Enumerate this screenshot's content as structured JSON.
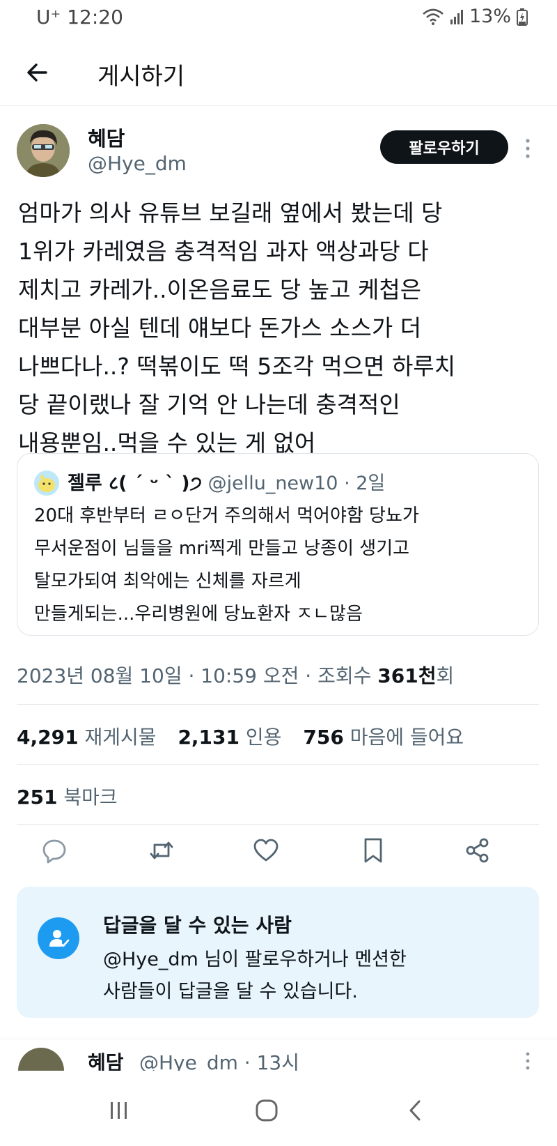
{
  "status_bar": {
    "carrier": "U⁺",
    "time": "12:20",
    "battery": "13%"
  },
  "header": {
    "title": "게시하기"
  },
  "author": {
    "name": "혜담",
    "handle": "@Hye_dm",
    "follow_label": "팔로우하기"
  },
  "tweet": {
    "text": "엄마가 의사 유튜브 보길래 옆에서 봤는데 당\n1위가 카레였음 충격적임 과자 액상과당 다\n제치고 카레가..이온음료도 당 높고 케첩은\n대부분 아실 텐데 얘보다 돈가스 소스가 더\n나쁘다나..? 떡볶이도 떡 5조각 먹으면 하루치\n당 끝이랬나 잘 기억 안 나는데 충격적인\n내용뿐임..먹을 수 있는 게 없어"
  },
  "quote": {
    "name": "젤루 ८( ˊ ᵕ ˋ )੭",
    "handle": "@jellu_new10 · 2일",
    "text": "20대 후반부터 ㄹㅇ단거 주의해서 먹어야함 당뇨가\n무서운점이 님들을 mri찍게 만들고 낭종이 생기고\n탈모가되여 최악에는 신체를 자르게\n만들게되는...우리병원에 당뇨환자 ㅈㄴ많음"
  },
  "meta": {
    "date": "2023년 08월 10일 · 10:59 오전 · 조회수 ",
    "views": "361천",
    "views_suffix": "회"
  },
  "stats": {
    "retweets": "4,291",
    "retweets_label": "재게시물",
    "quotes": "2,131",
    "quotes_label": "인용",
    "likes": "756",
    "likes_label": "마음에 들어요",
    "bookmarks": "251",
    "bookmarks_label": "북마크"
  },
  "actions": [
    "reply-icon",
    "retweet-icon",
    "like-icon",
    "bookmark-icon",
    "share-icon"
  ],
  "reply_notice": {
    "title": "답글을 달 수 있는 사람",
    "desc": "@Hye_dm 님이 팔로우하거나 멘션한\n사람들이 답글을 달 수 있습니다."
  },
  "next_tweet": {
    "name": "혜담",
    "handle": "@Hye_dm · 13시"
  },
  "colors": {
    "accent": "#1d9bf0",
    "text": "#0f1419",
    "secondary": "#536471",
    "notice_bg": "#e8f5fd"
  }
}
